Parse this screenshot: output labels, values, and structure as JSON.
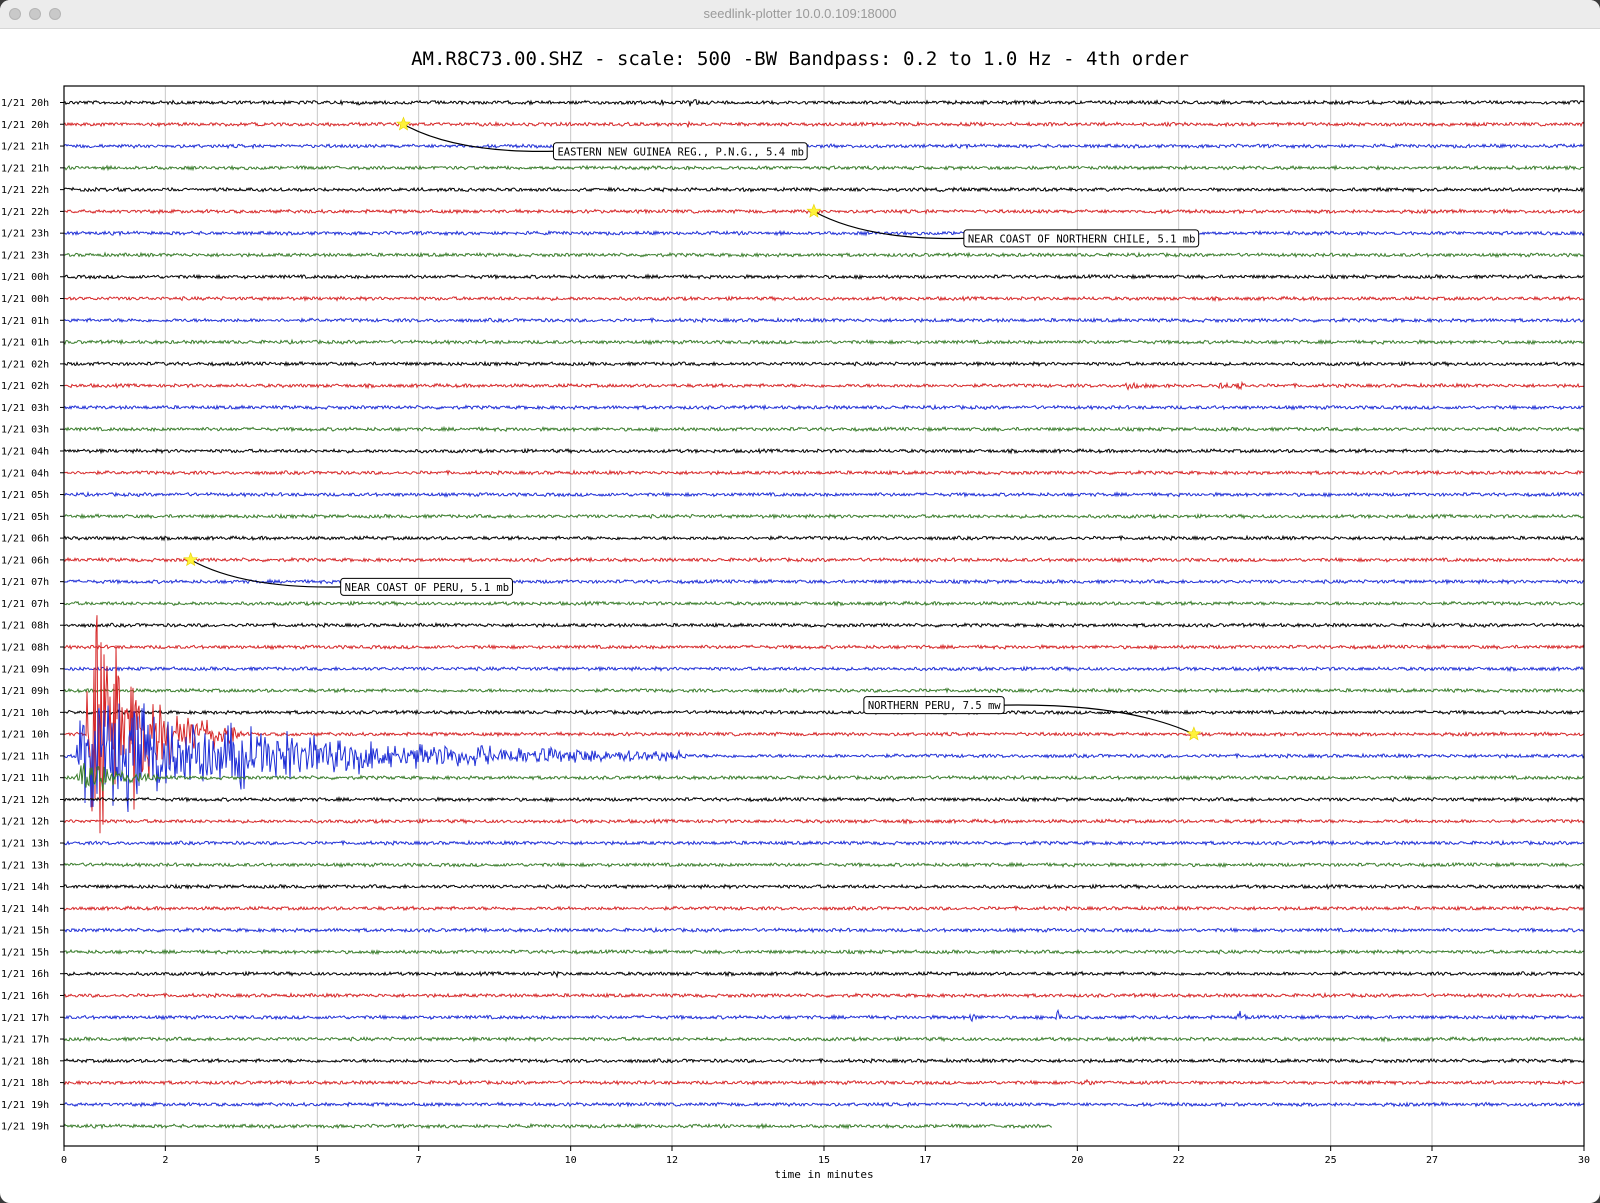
{
  "window": {
    "title": "seedlink-plotter 10.0.0.109:18000"
  },
  "chart_data": {
    "type": "line",
    "title": "AM.R8C73.00.SHZ - scale: 500 -BW Bandpass: 0.2 to 1.0 Hz - 4th order",
    "xlabel": "time in minutes",
    "ylabel": "",
    "xlim": [
      0,
      30
    ],
    "x_ticks": [
      0,
      2,
      5,
      7,
      10,
      12,
      15,
      17,
      20,
      22,
      25,
      27,
      30
    ],
    "x_tick_labels": [
      "0",
      "2",
      "5",
      "7",
      "10",
      "12",
      "15",
      "17",
      "20",
      "22",
      "25",
      "27",
      "30"
    ],
    "grid": true,
    "trace_colors": [
      "#000000",
      "#d62728",
      "#1f2fd6",
      "#3a7d2c"
    ],
    "row_labels": [
      "1/21 20h",
      "1/21 20h",
      "1/21 21h",
      "1/21 21h",
      "1/21 22h",
      "1/21 22h",
      "1/21 23h",
      "1/21 23h",
      "1/21 00h",
      "1/21 00h",
      "1/21 01h",
      "1/21 01h",
      "1/21 02h",
      "1/21 02h",
      "1/21 03h",
      "1/21 03h",
      "1/21 04h",
      "1/21 04h",
      "1/21 05h",
      "1/21 05h",
      "1/21 06h",
      "1/21 06h",
      "1/21 07h",
      "1/21 07h",
      "1/21 08h",
      "1/21 08h",
      "1/21 09h",
      "1/21 09h",
      "1/21 10h",
      "1/21 10h",
      "1/21 11h",
      "1/21 11h",
      "1/21 12h",
      "1/21 12h",
      "1/21 13h",
      "1/21 13h",
      "1/21 14h",
      "1/21 14h",
      "1/21 15h",
      "1/21 15h",
      "1/21 16h",
      "1/21 16h",
      "1/21 17h",
      "1/21 17h",
      "1/21 18h",
      "1/21 18h",
      "1/21 19h",
      "1/21 19h"
    ],
    "last_row_end_minute": 19.5,
    "bursts": [
      {
        "row": 0,
        "minute": 12.4,
        "amplitude": 14,
        "width": 0.15
      },
      {
        "row": 0,
        "minute": 11.8,
        "amplitude": 5,
        "width": 0.08
      },
      {
        "row": 0,
        "minute": 5.8,
        "amplitude": 4,
        "width": 0.05
      },
      {
        "row": 1,
        "minute": 12.3,
        "amplitude": 5,
        "width": 0.1
      },
      {
        "row": 6,
        "minute": 29.5,
        "amplitude": 10,
        "width": 0.05
      },
      {
        "row": 13,
        "minute": 23.2,
        "amplitude": 14,
        "width": 0.12
      },
      {
        "row": 13,
        "minute": 22.8,
        "amplitude": 5,
        "width": 0.3
      },
      {
        "row": 13,
        "minute": 21.0,
        "amplitude": 3,
        "width": 0.6
      },
      {
        "row": 29,
        "minute": 0.5,
        "amplitude": 180,
        "width": 3.0
      },
      {
        "row": 30,
        "minute": 0.3,
        "amplitude": 75,
        "width": 12.0
      },
      {
        "row": 31,
        "minute": 0.3,
        "amplitude": 30,
        "width": 1.8
      },
      {
        "row": 40,
        "minute": 9.7,
        "amplitude": 4,
        "width": 0.1
      },
      {
        "row": 42,
        "minute": 17.9,
        "amplitude": 10,
        "width": 0.15
      },
      {
        "row": 42,
        "minute": 19.6,
        "amplitude": 14,
        "width": 0.2
      },
      {
        "row": 42,
        "minute": 23.2,
        "amplitude": 16,
        "width": 0.15
      },
      {
        "row": 45,
        "minute": 20.2,
        "amplitude": 6,
        "width": 0.15
      },
      {
        "row": 45,
        "minute": 13.5,
        "amplitude": 5,
        "width": 0.15
      }
    ],
    "events": [
      {
        "label": "EASTERN NEW GUINEA REG., P.N.G., 5.4 mb",
        "row": 1,
        "minute": 6.7
      },
      {
        "label": "NEAR COAST OF NORTHERN CHILE, 5.1 mb",
        "row": 5,
        "minute": 14.8
      },
      {
        "label": "NEAR COAST OF PERU, 5.1 mb",
        "row": 21,
        "minute": 2.5
      },
      {
        "label": "NORTHERN PERU, 7.5 mw",
        "row": 29,
        "minute": 22.3
      }
    ]
  }
}
